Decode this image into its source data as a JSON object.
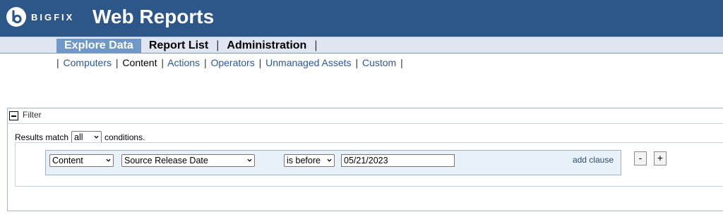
{
  "header": {
    "logo_text": "BIGFIX",
    "title": "Web Reports",
    "brand_color": "#2d5789"
  },
  "menu": {
    "items": [
      {
        "label": "Explore Data",
        "active": true
      },
      {
        "label": "Report List",
        "active": false
      },
      {
        "label": "Administration",
        "active": false
      }
    ],
    "separator": "|"
  },
  "subnav": {
    "separator": "|",
    "items": [
      {
        "label": "Computers",
        "current": false
      },
      {
        "label": "Content",
        "current": true
      },
      {
        "label": "Actions",
        "current": false
      },
      {
        "label": "Operators",
        "current": false
      },
      {
        "label": "Unmanaged Assets",
        "current": false
      },
      {
        "label": "Custom",
        "current": false
      }
    ]
  },
  "filter": {
    "title": "Filter",
    "results_prefix": "Results match",
    "match_mode": "all",
    "results_suffix": "conditions.",
    "clause": {
      "object": "Content",
      "property": "Source Release Date",
      "operator": "is before",
      "value": "05/21/2023",
      "add_clause_label": "add clause"
    },
    "remove_label": "-",
    "add_label": "+"
  }
}
